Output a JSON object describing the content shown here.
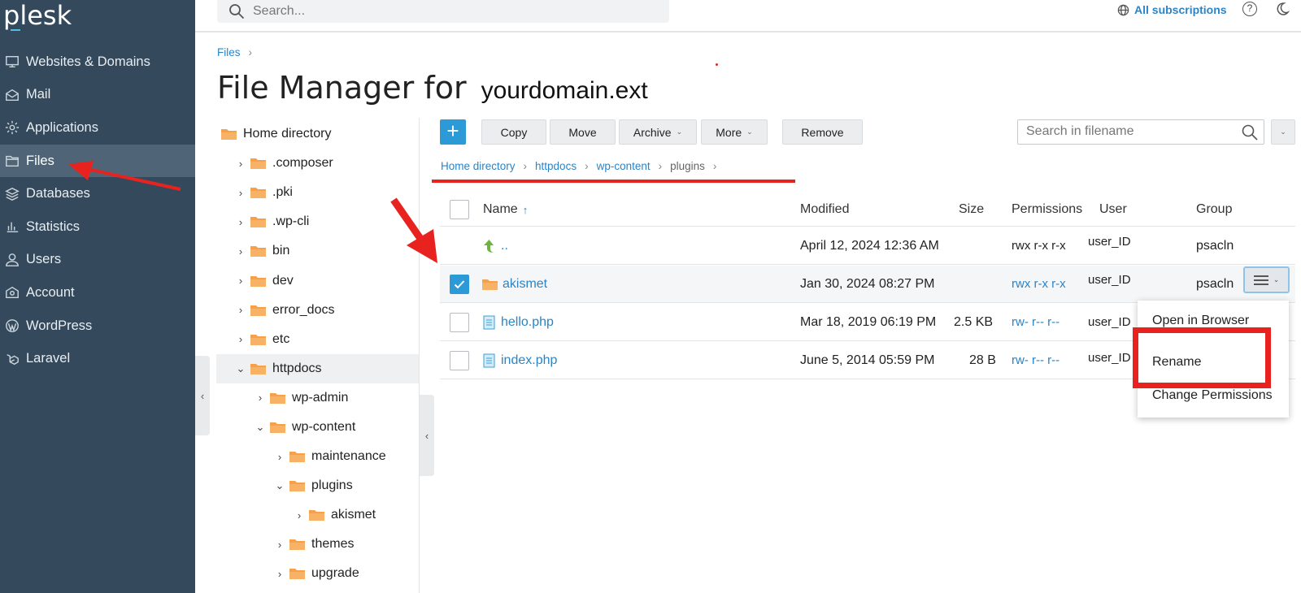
{
  "app": {
    "logo": "plesk"
  },
  "sidebar": {
    "items": [
      {
        "label": "Websites & Domains",
        "icon": "monitor-icon"
      },
      {
        "label": "Mail",
        "icon": "mail-icon"
      },
      {
        "label": "Applications",
        "icon": "gear-icon"
      },
      {
        "label": "Files",
        "icon": "folder-icon",
        "active": true
      },
      {
        "label": "Databases",
        "icon": "database-icon"
      },
      {
        "label": "Statistics",
        "icon": "bar-chart-icon"
      },
      {
        "label": "Users",
        "icon": "user-icon"
      },
      {
        "label": "Account",
        "icon": "account-icon"
      },
      {
        "label": "WordPress",
        "icon": "wordpress-icon"
      },
      {
        "label": "Laravel",
        "icon": "laravel-icon"
      }
    ]
  },
  "topbar": {
    "search_placeholder": "Search...",
    "subscriptions_label": "All subscriptions",
    "help_label": "?"
  },
  "header": {
    "breadcrumb": "Files",
    "title": "File Manager for",
    "domain": "yourdomain.ext"
  },
  "tree": {
    "items": [
      {
        "label": "Home directory",
        "depth": 0,
        "chevron": ""
      },
      {
        "label": ".composer",
        "depth": 1,
        "chevron": "›"
      },
      {
        "label": ".pki",
        "depth": 1,
        "chevron": "›"
      },
      {
        "label": ".wp-cli",
        "depth": 1,
        "chevron": "›"
      },
      {
        "label": "bin",
        "depth": 1,
        "chevron": "›"
      },
      {
        "label": "dev",
        "depth": 1,
        "chevron": "›"
      },
      {
        "label": "error_docs",
        "depth": 1,
        "chevron": "›"
      },
      {
        "label": "etc",
        "depth": 1,
        "chevron": "›"
      },
      {
        "label": "httpdocs",
        "depth": 1,
        "chevron": "⌄",
        "active": true
      },
      {
        "label": "wp-admin",
        "depth": 2,
        "chevron": "›"
      },
      {
        "label": "wp-content",
        "depth": 2,
        "chevron": "⌄"
      },
      {
        "label": "maintenance",
        "depth": 3,
        "chevron": "›"
      },
      {
        "label": "plugins",
        "depth": 3,
        "chevron": "⌄"
      },
      {
        "label": "akismet",
        "depth": 4,
        "chevron": "›"
      },
      {
        "label": "themes",
        "depth": 3,
        "chevron": "›"
      },
      {
        "label": "upgrade",
        "depth": 3,
        "chevron": "›"
      }
    ]
  },
  "toolbar": {
    "add_label": "+",
    "copy_label": "Copy",
    "move_label": "Move",
    "archive_label": "Archive",
    "more_label": "More",
    "remove_label": "Remove",
    "search_placeholder": "Search in filename"
  },
  "path": {
    "items": [
      "Home directory",
      "httpdocs",
      "wp-content"
    ],
    "current": "plugins"
  },
  "table": {
    "headers": {
      "name": "Name",
      "sort_indicator": "↑",
      "modified": "Modified",
      "size": "Size",
      "permissions": "Permissions",
      "user": "User",
      "group": "Group"
    },
    "rows": [
      {
        "name": "..",
        "type": "parent",
        "modified": "April 12, 2024 12:36 AM",
        "size": "",
        "permissions": "rwx r-x r-x",
        "user": "user_ID",
        "group": "psacln",
        "checked": false,
        "has_checkbox": false
      },
      {
        "name": "akismet",
        "type": "folder",
        "modified": "Jan 30, 2024 08:27 PM",
        "size": "",
        "permissions": "rwx r-x r-x",
        "user": "user_ID",
        "group": "psacln",
        "checked": true,
        "has_checkbox": true
      },
      {
        "name": "hello.php",
        "type": "file",
        "modified": "Mar 18, 2019 06:19 PM",
        "size": "2.5 KB",
        "permissions": "rw- r-- r--",
        "user": "user_ID",
        "group": "",
        "checked": false,
        "has_checkbox": true
      },
      {
        "name": "index.php",
        "type": "file",
        "modified": "June 5, 2014 05:59 PM",
        "size": "28 B",
        "permissions": "rw- r-- r--",
        "user": "user_ID",
        "group": "",
        "checked": false,
        "has_checkbox": true
      }
    ]
  },
  "context_menu": {
    "items": [
      "Open in Browser",
      "Rename",
      "Change Permissions"
    ]
  },
  "colors": {
    "sidebar_bg": "#344a5c",
    "accent": "#2b9ad6",
    "link": "#2b84c6",
    "folder": "#f5a04a",
    "annotation_red": "#e8231f"
  }
}
